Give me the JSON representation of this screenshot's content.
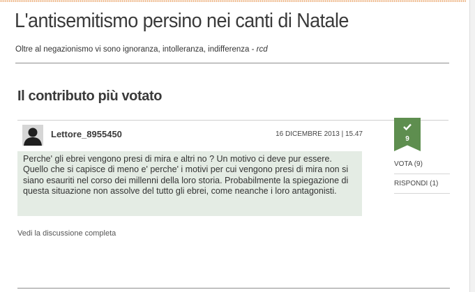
{
  "article": {
    "title": "L'antisemitismo persino nei canti di Natale",
    "subtitle": "Oltre al negazionismo vi sono ignoranza, intolleranza, indifferenza - ",
    "subtitle_author": "rcd"
  },
  "section": {
    "title": "Il contributo più votato"
  },
  "comment": {
    "author": "Lettore_8955450",
    "timestamp": "16 DICEMBRE 2013 | 15.47",
    "body": "Perche' gli ebrei vengono presi di mira e altri no ? Un motivo ci deve pur essere. Quello che si capisce di meno e' perche' i motivi per cui vengono presi di mira non si siano esauriti nel corso dei millenni della loro storia. Probabilmente la spiegazione di questa situazione non assolve del tutto gli ebrei, come neanche i loro antagonisti.",
    "vote_count": "9",
    "vote_label": "VOTA (9)",
    "reply_label": "RISPONDI (1)"
  },
  "footer": {
    "discussion_link": "Vedi la discussione completa"
  },
  "icons": {
    "avatar": "user-silhouette-icon",
    "vote": "checkmark-icon"
  },
  "colors": {
    "vote_badge": "#5e8e4f",
    "comment_background": "#e4ece4",
    "top_dots": "#e8a063"
  }
}
